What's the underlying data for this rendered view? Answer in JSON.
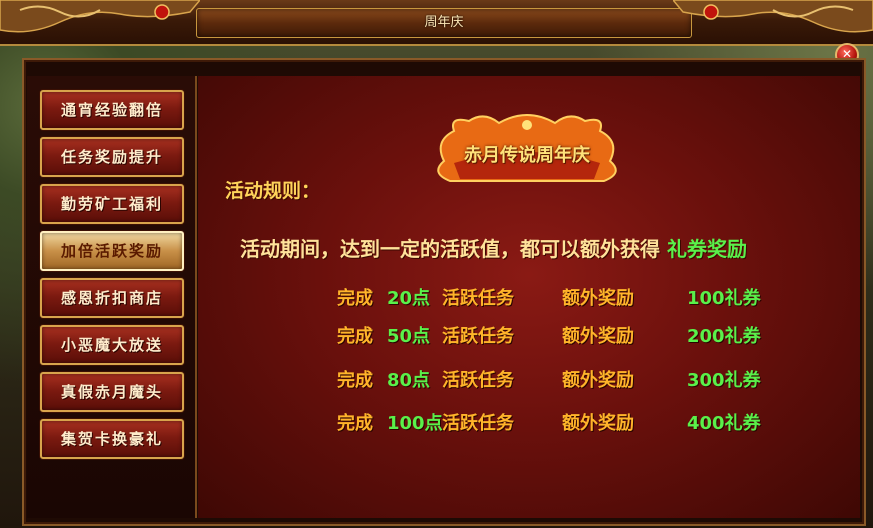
{
  "window": {
    "title": "周年庆"
  },
  "sidebar": {
    "items": [
      {
        "label": "通宵经验翻倍",
        "active": false
      },
      {
        "label": "任务奖励提升",
        "active": false
      },
      {
        "label": "勤劳矿工福利",
        "active": false
      },
      {
        "label": "加倍活跃奖励",
        "active": true
      },
      {
        "label": "感恩折扣商店",
        "active": false
      },
      {
        "label": "小恶魔大放送",
        "active": false
      },
      {
        "label": "真假赤月魔头",
        "active": false
      },
      {
        "label": "集贺卡换豪礼",
        "active": false
      }
    ]
  },
  "main": {
    "banner": "赤月传说周年庆",
    "rules_title": "活动规则：",
    "description": "活动期间，达到一定的活跃值，都可以额外获得",
    "description_highlight": "礼券奖励",
    "rows": [
      {
        "complete": "完成",
        "points": "20点",
        "task": "活跃任务",
        "extra": "额外奖励",
        "reward": "100礼券"
      },
      {
        "complete": "完成",
        "points": "50点",
        "task": "活跃任务",
        "extra": "额外奖励",
        "reward": "200礼券"
      },
      {
        "complete": "完成",
        "points": "80点",
        "task": "活跃任务",
        "extra": "额外奖励",
        "reward": "300礼券"
      },
      {
        "complete": "完成",
        "points": "100点",
        "task": "活跃任务",
        "extra": "额外奖励",
        "reward": "400礼券"
      }
    ]
  },
  "icons": {
    "close": "close-icon"
  },
  "colors": {
    "highlight_green": "#5af04a",
    "text_gold": "#ffb42a",
    "active_tab": "#c89048"
  }
}
